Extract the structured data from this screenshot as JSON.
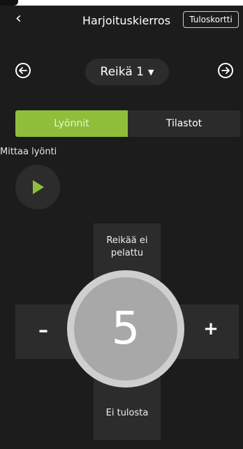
{
  "header": {
    "title": "Harjoituskierros",
    "scorecard_label": "Tuloskortti"
  },
  "hole_nav": {
    "current_hole": "Reikä 1"
  },
  "tabs": [
    {
      "label": "Lyönnit",
      "active": true
    },
    {
      "label": "Tilastot",
      "active": false
    }
  ],
  "measure": {
    "label": "Mittaa lyönti"
  },
  "score": {
    "value": "5",
    "top_option": "Reikää ei pelattu",
    "bottom_option": "Ei tulosta",
    "minus": "–",
    "plus": "+"
  },
  "colors": {
    "accent": "#8fbf3a",
    "background": "#1c1c1c",
    "panel": "#2c2c2c"
  },
  "icons": {
    "back": "chevron-left-icon",
    "prev": "arrow-left-circle-icon",
    "next": "arrow-right-circle-icon",
    "dropdown": "caret-down-icon",
    "play": "play-icon"
  }
}
